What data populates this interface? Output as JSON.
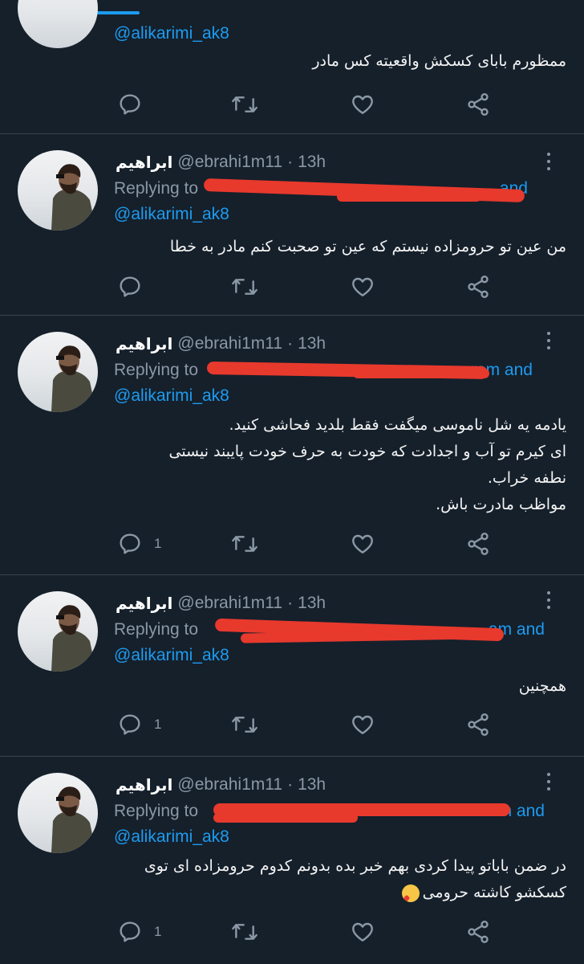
{
  "tweets": [
    {
      "name": "",
      "handle": "",
      "time": "",
      "reply_prefix": "",
      "reply_tail": "",
      "mention": "@alikarimi_ak8",
      "lines": [
        "ممظورم بابای کسکش واقعیته کس مادر"
      ],
      "reply_count": ""
    },
    {
      "name": "ابراهیم",
      "handle": "@ebrahi1m11",
      "time": "13h",
      "reply_prefix": "Replying to",
      "reply_tail": "and",
      "mention": "@alikarimi_ak8",
      "lines": [
        "من عین تو حرومزاده نیستم که عین تو صحبت کنم مادر به خطا"
      ],
      "reply_count": ""
    },
    {
      "name": "ابراهیم",
      "handle": "@ebrahi1m11",
      "time": "13h",
      "reply_prefix": "Replying to",
      "reply_tail": "ram and",
      "mention": "@alikarimi_ak8",
      "lines": [
        "یادمه یه شل ناموسی میگفت فقط بلدید فحاشی کنید.",
        "ای کیرم تو آب و اجدادت که خودت به حرف خودت پایبند نیستی",
        "نطفه خراب.",
        "مواظب مادرت باش."
      ],
      "reply_count": "1"
    },
    {
      "name": "ابراهیم",
      "handle": "@ebrahi1m11",
      "time": "13h",
      "reply_prefix": "Replying to",
      "reply_tail": "am and",
      "mention": "@alikarimi_ak8",
      "lines": [
        "همچنین"
      ],
      "reply_count": "1"
    },
    {
      "name": "ابراهیم",
      "handle": "@ebrahi1m11",
      "time": "13h",
      "reply_prefix": "Replying to",
      "reply_tail": "am and",
      "mention": "@alikarimi_ak8",
      "lines": [
        "در ضمن باباتو پیدا کردی بهم خبر بده بدونم کدوم حرومزاده ای توی",
        "کسکشو کاشته حرومی"
      ],
      "reply_count": "1"
    }
  ],
  "header_separator": "·",
  "colors": {
    "background": "#15202b",
    "accent": "#1d9bf0",
    "muted": "#8b98a5",
    "redaction": "#e8392d",
    "divider": "#38444d"
  },
  "icons": {
    "reply": "reply-icon",
    "retweet": "retweet-icon",
    "like": "heart-icon",
    "share": "share-icon",
    "more": "more-icon"
  }
}
